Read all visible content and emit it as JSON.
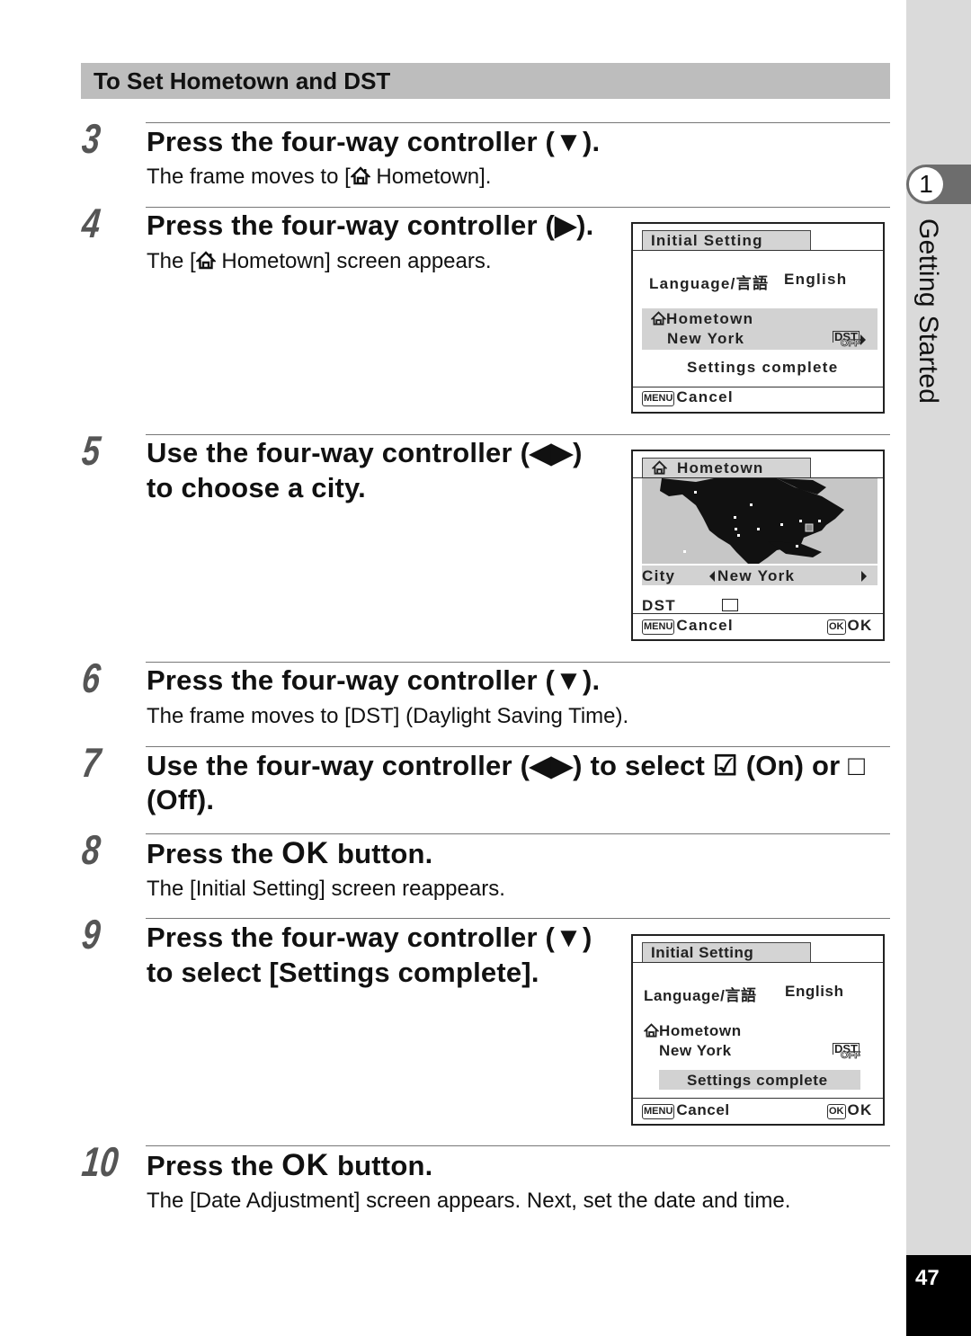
{
  "section": {
    "title": "To Set Hometown and DST"
  },
  "steps": [
    {
      "number": "3",
      "title": "Press the four-way controller (▼).",
      "desc_before": "The frame moves to [",
      "desc_icon": "home-icon",
      "desc_after": " Hometown]."
    },
    {
      "number": "4",
      "title": "Press the four-way controller (▶).",
      "desc_before": "The [",
      "desc_icon": "home-icon",
      "desc_after": " Hometown] screen appears."
    },
    {
      "number": "5",
      "title_line1": "Use the four-way controller (◀▶)",
      "title_line2": "to choose a city."
    },
    {
      "number": "6",
      "title": "Press the four-way controller (▼).",
      "desc": "The frame moves to [DST] (Daylight Saving Time)."
    },
    {
      "number": "7",
      "title_line1": "Use the four-way controller (◀▶) to select ☑ (On) or □",
      "title_line2": "(Off)."
    },
    {
      "number": "8",
      "title_before": "Press the ",
      "title_ok": "OK",
      "title_after": " button.",
      "desc": "The [Initial Setting] screen reappears."
    },
    {
      "number": "9",
      "title_line1": "Press the four-way controller (▼)",
      "title_line2": "to select [Settings complete]."
    },
    {
      "number": "10",
      "title_before": "Press the ",
      "title_ok": "OK",
      "title_after": " button.",
      "desc": "The [Date Adjustment] screen appears. Next, set the date and time."
    }
  ],
  "screens": {
    "initial_setting_1": {
      "tab": "Initial Setting",
      "language_label": "Language/言語",
      "language_value": "English",
      "hometown_label": "Hometown",
      "hometown_city": "New York",
      "dst_top": "DST",
      "dst_bottom": "OFF",
      "settings_complete": "Settings complete",
      "menu_key": "MENU",
      "cancel": "Cancel",
      "highlighted": "hometown"
    },
    "hometown": {
      "tab": "Hometown",
      "city_label": "City",
      "city_value": "New York",
      "dst_label": "DST",
      "dst_checked": false,
      "menu_key": "MENU",
      "cancel": "Cancel",
      "ok_key": "OK",
      "ok": "OK"
    },
    "initial_setting_2": {
      "tab": "Initial Setting",
      "language_label": "Language/言語",
      "language_value": "English",
      "hometown_label": "Hometown",
      "hometown_city": "New York",
      "dst_top": "DST",
      "dst_bottom": "OFF",
      "settings_complete": "Settings complete",
      "menu_key": "MENU",
      "cancel": "Cancel",
      "ok_key": "OK",
      "ok": "OK",
      "highlighted": "settings_complete"
    }
  },
  "side_tab": {
    "chapter_number": "1",
    "chapter_title": "Getting Started"
  },
  "page_number": "47"
}
